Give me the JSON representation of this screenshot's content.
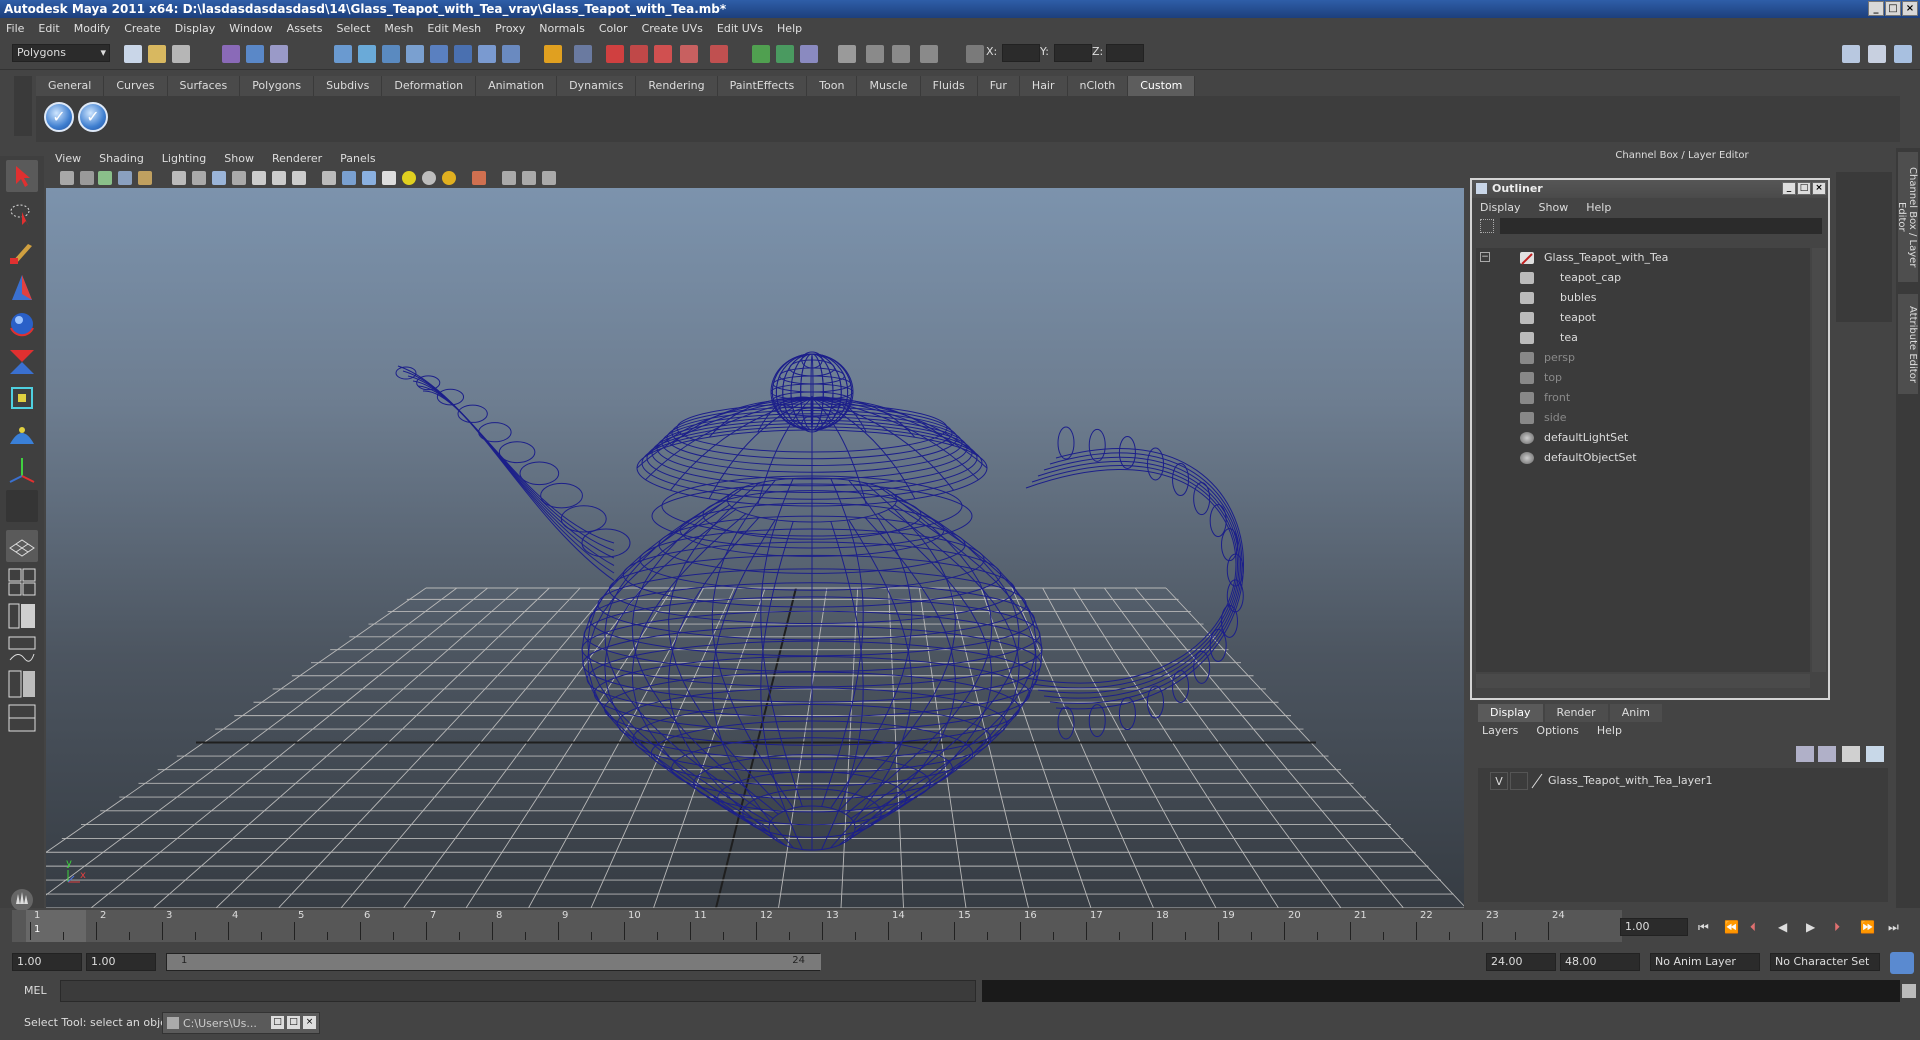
{
  "window": {
    "title": "Autodesk Maya 2011 x64: D:\\lasdasdasdasdasd\\14\\Glass_Teapot_with_Tea_vray\\Glass_Teapot_with_Tea.mb*"
  },
  "menubar": [
    "File",
    "Edit",
    "Modify",
    "Create",
    "Display",
    "Window",
    "Assets",
    "Select",
    "Mesh",
    "Edit Mesh",
    "Proxy",
    "Normals",
    "Color",
    "Create UVs",
    "Edit UVs",
    "Help"
  ],
  "status_line": {
    "mode": "Polygons",
    "x_label": "X:",
    "y_label": "Y:",
    "z_label": "Z:"
  },
  "shelf_tabs": [
    "General",
    "Curves",
    "Surfaces",
    "Polygons",
    "Subdivs",
    "Deformation",
    "Animation",
    "Dynamics",
    "Rendering",
    "PaintEffects",
    "Toon",
    "Muscle",
    "Fluids",
    "Fur",
    "Hair",
    "nCloth",
    "Custom"
  ],
  "shelf_active_tab": "Custom",
  "viewport_menu": [
    "View",
    "Shading",
    "Lighting",
    "Show",
    "Renderer",
    "Panels"
  ],
  "viewport": {
    "axis_y": "y",
    "axis_x": "x"
  },
  "channel_box_title": "Channel Box / Layer Editor",
  "outliner": {
    "title": "Outliner",
    "menu": [
      "Display",
      "Show",
      "Help"
    ],
    "items": [
      {
        "label": "Glass_Teapot_with_Tea",
        "icon": "group-icon"
      },
      {
        "label": "teapot_cap",
        "icon": "mesh-icon"
      },
      {
        "label": "bubles",
        "icon": "mesh-icon"
      },
      {
        "label": "teapot",
        "icon": "mesh-icon"
      },
      {
        "label": "tea",
        "icon": "mesh-icon"
      },
      {
        "label": "persp",
        "icon": "camera-icon"
      },
      {
        "label": "top",
        "icon": "camera-icon"
      },
      {
        "label": "front",
        "icon": "camera-icon"
      },
      {
        "label": "side",
        "icon": "camera-icon"
      },
      {
        "label": "defaultLightSet",
        "icon": "set-icon"
      },
      {
        "label": "defaultObjectSet",
        "icon": "set-icon"
      }
    ]
  },
  "layer_editor": {
    "tabs": [
      "Display",
      "Render",
      "Anim"
    ],
    "active_tab": "Display",
    "menu": [
      "Layers",
      "Options",
      "Help"
    ],
    "layers": [
      {
        "visible": "V",
        "name": "Glass_Teapot_with_Tea_layer1"
      }
    ]
  },
  "side_tabs": [
    "Channel Box / Layer Editor",
    "Attribute Editor"
  ],
  "timeline": {
    "ticks": [
      "1",
      "2",
      "3",
      "4",
      "5",
      "6",
      "7",
      "8",
      "9",
      "10",
      "11",
      "12",
      "13",
      "14",
      "15",
      "16",
      "17",
      "18",
      "19",
      "20",
      "21",
      "22",
      "23",
      "24"
    ],
    "current_frame": "1.00"
  },
  "range": {
    "start": "1.00",
    "playback_start": "1.00",
    "slider_start": "1",
    "slider_end": "24",
    "playback_end": "24.00",
    "end": "48.00",
    "anim_layer": "No Anim Layer",
    "character_set": "No Character Set"
  },
  "command_line": {
    "label": "MEL"
  },
  "status_bar": {
    "help_text": "Select Tool: select an object",
    "task_item": "C:\\Users\\Us..."
  },
  "colors": {
    "wireframe": "#1c1f8a",
    "grid": "#b8b8b8",
    "title_bar": "#2f5ea8"
  }
}
